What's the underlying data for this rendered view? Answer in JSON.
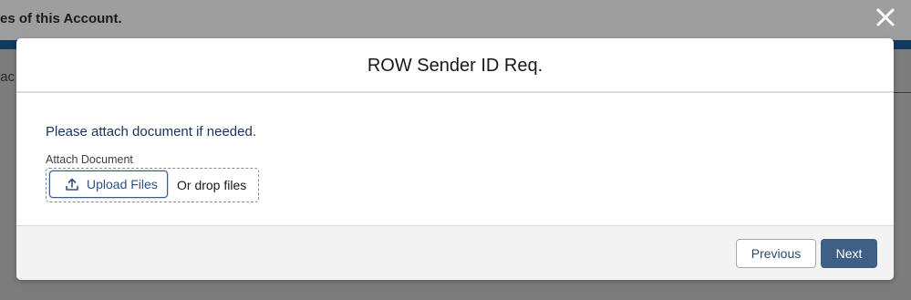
{
  "background": {
    "banner_text": "es of this Account.",
    "tab_fragment": "tac"
  },
  "modal": {
    "title": "ROW Sender ID Req.",
    "instruction": "Please attach document if needed.",
    "attach_label": "Attach Document",
    "upload_button_label": "Upload Files",
    "drop_text": "Or drop files",
    "previous_label": "Previous",
    "next_label": "Next"
  },
  "icons": {
    "close": "close-icon",
    "upload": "upload-icon"
  },
  "colors": {
    "primary_button": "#3f5f84",
    "upload_text": "#2b5283",
    "instruction_text": "#16325c"
  }
}
